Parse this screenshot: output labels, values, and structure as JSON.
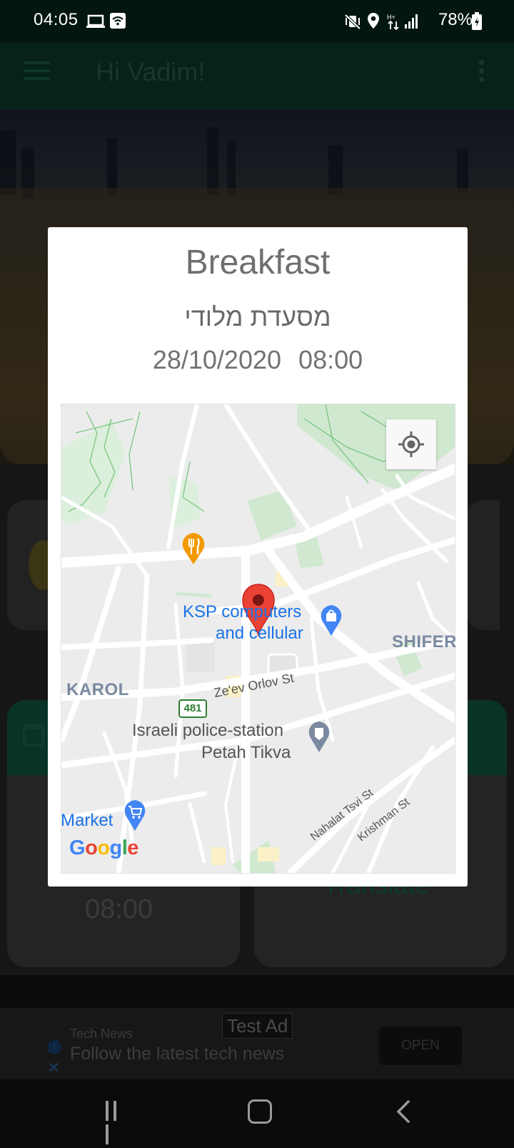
{
  "status_bar": {
    "time": "04:05",
    "battery": "78%"
  },
  "app_bar": {
    "greeting": "Hi Vadim!"
  },
  "background": {
    "card_time": "08:00",
    "card_translate": "Translate"
  },
  "ad": {
    "test_label": "Test Ad",
    "source": "Tech News",
    "headline": "Follow the latest tech news",
    "open_label": "OPEN"
  },
  "dialog": {
    "title": "Breakfast",
    "place": "מסעדת מלודי",
    "date": "28/10/2020",
    "time": "08:00"
  },
  "map": {
    "labels": {
      "ksp_line1": "KSP computers",
      "ksp_line2": "and cellular",
      "shifer": "SHIFER",
      "karol": "KAROL",
      "orlov_street": "Ze'ev Orlov St",
      "route_number": "481",
      "police_line1": "Israeli police-station",
      "police_line2": "Petah Tikva",
      "market": "Market",
      "nahalat_street": "Nahalat Tsvi St",
      "krishman_street": "Krishman St"
    },
    "google_logo": [
      "G",
      "o",
      "o",
      "g",
      "l",
      "e"
    ],
    "pin_color": "#ea4335",
    "park_color": "#c8e6c9"
  },
  "colors": {
    "primary": "#0a3328",
    "accent_blue": "#1a73e8",
    "restaurant_marker": "#f29900"
  }
}
